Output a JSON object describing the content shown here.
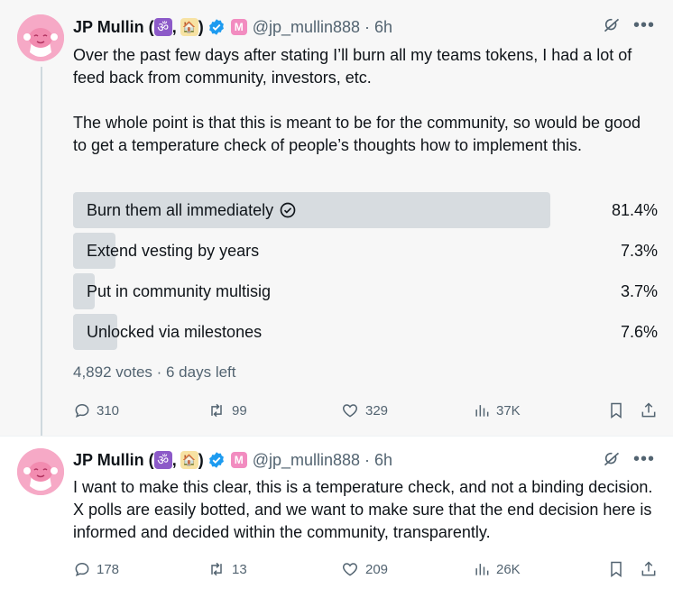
{
  "colors": {
    "verified_blue": "#1d9bf0",
    "poll_bar": "#d7dce0",
    "muted_text": "#536471",
    "avatar_pink": "#f6a9c6",
    "badge_pink": "#f28cc0"
  },
  "tweets": [
    {
      "author": {
        "name": "JP Mullin (",
        "emoji_1": "ॐ",
        "separator": ",",
        "emoji_2": "🏠",
        "close_paren": ")",
        "badge_letter": "M",
        "handle": "@jp_mullin888",
        "time": "· 6h"
      },
      "text": "Over the past few days after stating I’ll burn all my teams tokens, I had a lot of feed back from community, investors, etc.\n\nThe whole point is that this is meant to be for the community, so would be good to get a temperature check of people’s thoughts how to implement this.",
      "poll": {
        "options": [
          {
            "label": "Burn them all immediately",
            "percent_text": "81.4%",
            "percent": 81.4,
            "selected": true
          },
          {
            "label": "Extend vesting by years",
            "percent_text": "7.3%",
            "percent": 7.3,
            "selected": false
          },
          {
            "label": "Put in community multisig",
            "percent_text": "3.7%",
            "percent": 3.7,
            "selected": false
          },
          {
            "label": "Unlocked via milestones",
            "percent_text": "7.6%",
            "percent": 7.6,
            "selected": false
          }
        ],
        "meta": "4,892 votes · 6 days left"
      },
      "stats": {
        "replies": "310",
        "reposts": "99",
        "likes": "329",
        "views": "37K"
      }
    },
    {
      "author": {
        "name": "JP Mullin (",
        "emoji_1": "ॐ",
        "separator": ",",
        "emoji_2": "🏠",
        "close_paren": ")",
        "badge_letter": "M",
        "handle": "@jp_mullin888",
        "time": "· 6h"
      },
      "text": "I want to make this clear, this is a temperature check, and not a binding decision. X polls are easily botted, and we want to make sure that the end decision here is informed and decided within the community, transparently.",
      "stats": {
        "replies": "178",
        "reposts": "13",
        "likes": "209",
        "views": "26K"
      }
    }
  ]
}
